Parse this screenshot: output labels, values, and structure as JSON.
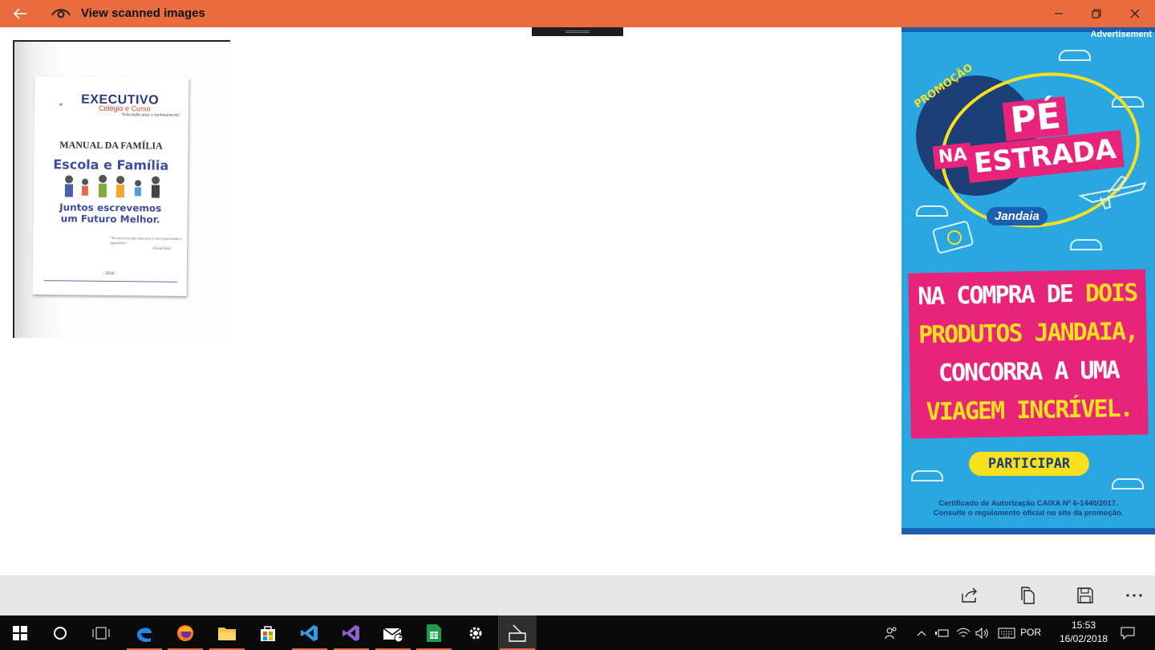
{
  "window": {
    "title": "View scanned images",
    "back_icon": "arrow-left-icon",
    "app_icon": "eye-icon",
    "controls": [
      "minimize-icon",
      "restore-icon",
      "close-icon"
    ],
    "accent_color": "#e96c3f"
  },
  "document_thumbnail": {
    "brand": "EXECUTIVO",
    "brand_sub": "Colégio e Curso",
    "tagline": "\"Educação para o conhecimento\"",
    "heading": "MANUAL DA FAMÍLIA",
    "subheading": "Escola e Família",
    "motto_line1": "Juntos escrevemos",
    "motto_line2": "um Futuro Melhor.",
    "quote": "\"Se você acha que educação é cara experimente a ignorância\"",
    "quote_author": "(Derek Bok)",
    "year": "- 2018 -"
  },
  "advertisement": {
    "label": "Advertisement",
    "promo": "PROMOÇÃO",
    "headline_1": "PÉ",
    "headline_2": "NA",
    "headline_3": "ESTRADA",
    "brand": "Jandaia",
    "message_line1_a": "NA COMPRA DE ",
    "message_line1_b": "DOIS",
    "message_line2": "PRODUTOS JANDAIA,",
    "message_line3": "CONCORRA A UMA",
    "message_line4": "VIAGEM INCRÍVEL.",
    "button": "PARTICIPAR",
    "fine_print_1": "Certificado de Autorização CAIXA Nº 6-1440/2017.",
    "fine_print_2": "Consulte o regulamento oficial no site da promoção.",
    "colors": {
      "background": "#2aa7e0",
      "pink": "#e8237a",
      "yellow": "#f7e01e",
      "navy": "#1d3f78"
    }
  },
  "command_bar": {
    "buttons": [
      "share-icon",
      "copy-icon",
      "save-icon",
      "more-icon"
    ]
  },
  "taskbar": {
    "apps": [
      "start-icon",
      "cortana-icon",
      "task-view-icon",
      "edge-icon",
      "firefox-icon",
      "file-explorer-icon",
      "store-icon",
      "vscode-icon",
      "visual-studio-icon",
      "mail-icon",
      "sheets-icon",
      "settings-icon",
      "scanner-app-icon"
    ],
    "mail_badge": "1",
    "language": "POR",
    "time": "15:53",
    "date": "16/02/2018"
  }
}
